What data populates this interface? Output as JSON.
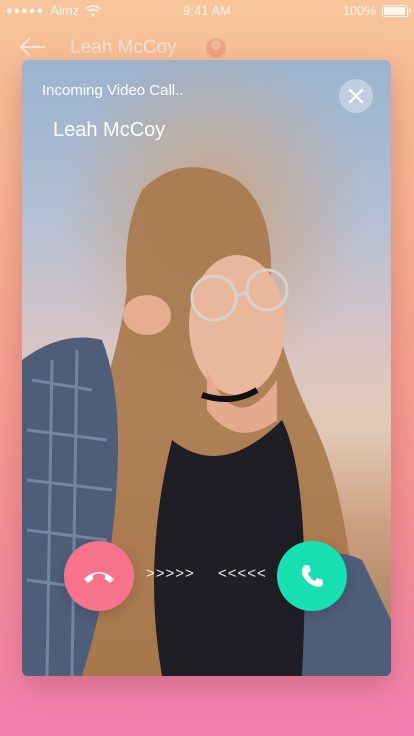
{
  "status_bar": {
    "signal_dots": "●●●●●",
    "carrier": "Almz",
    "time": "9:41 AM",
    "battery": "100%",
    "icons": [
      "wifi-icon",
      "battery-icon"
    ]
  },
  "header": {
    "title": "Leah McCoy",
    "back_icon": "back-arrow-icon"
  },
  "call": {
    "label": "Incoming Video Call..",
    "caller_name": "Leah McCoy",
    "close_icon": "close-icon",
    "decline_icon": "phone-hangup-icon",
    "accept_icon": "phone-icon",
    "swipe_right": ">>>>>",
    "swipe_left": "<<<<<"
  },
  "colors": {
    "decline": "#f7738b",
    "accept": "#17e0b3",
    "background_top": "#f8c59a",
    "background_bottom": "#f27fb0"
  }
}
